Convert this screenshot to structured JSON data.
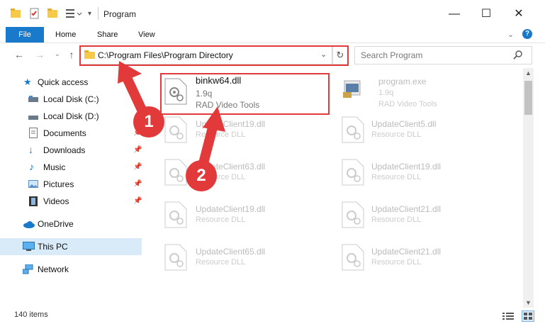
{
  "window": {
    "title": "Program",
    "minimize": "—",
    "maximize": "☐",
    "close": "✕"
  },
  "ribbon": {
    "file": "File",
    "home": "Home",
    "share": "Share",
    "view": "View"
  },
  "address": {
    "path": "C:\\Program Files\\Program Directory"
  },
  "search": {
    "placeholder": "Search Program"
  },
  "sidebar": {
    "items": [
      {
        "label": "Quick access",
        "icon": "star-icon"
      },
      {
        "label": "Local Disk (C:)",
        "icon": "drive-icon"
      },
      {
        "label": "Local Disk (D:)",
        "icon": "drive-icon"
      },
      {
        "label": "Documents",
        "icon": "documents-icon"
      },
      {
        "label": "Downloads",
        "icon": "download-arrow-icon"
      },
      {
        "label": "Music",
        "icon": "music-note-icon"
      },
      {
        "label": "Pictures",
        "icon": "pictures-icon"
      },
      {
        "label": "Videos",
        "icon": "film-icon"
      },
      {
        "label": "OneDrive",
        "icon": "cloud-icon"
      },
      {
        "label": "This PC",
        "icon": "monitor-icon"
      },
      {
        "label": "Network",
        "icon": "network-icon"
      }
    ]
  },
  "files": {
    "highlighted": {
      "name": "binkw64.dll",
      "version": "1.9q",
      "company": "RAD Video Tools"
    },
    "program": {
      "name": "program.exe",
      "version": "1.9q",
      "company": "RAD Video Tools"
    },
    "grid": [
      {
        "name": "UpdateClient19.dll",
        "type": "Resource DLL"
      },
      {
        "name": "UpdateClient5.dll",
        "type": "Resource DLL"
      },
      {
        "name": "UpdateClient63.dll",
        "type": "Resource DLL"
      },
      {
        "name": "UpdateClient19.dll",
        "type": "Resource DLL"
      },
      {
        "name": "UpdateClient19.dll",
        "type": "Resource DLL"
      },
      {
        "name": "UpdateClient21.dll",
        "type": "Resource DLL"
      },
      {
        "name": "UpdateClient65.dll",
        "type": "Resource DLL"
      },
      {
        "name": "UpdateClient21.dll",
        "type": "Resource DLL"
      }
    ]
  },
  "status": {
    "count": "140 items"
  },
  "annotations": {
    "one": "1",
    "two": "2"
  },
  "colors": {
    "accent": "#1979ca",
    "highlight_red": "#e23a3a"
  }
}
